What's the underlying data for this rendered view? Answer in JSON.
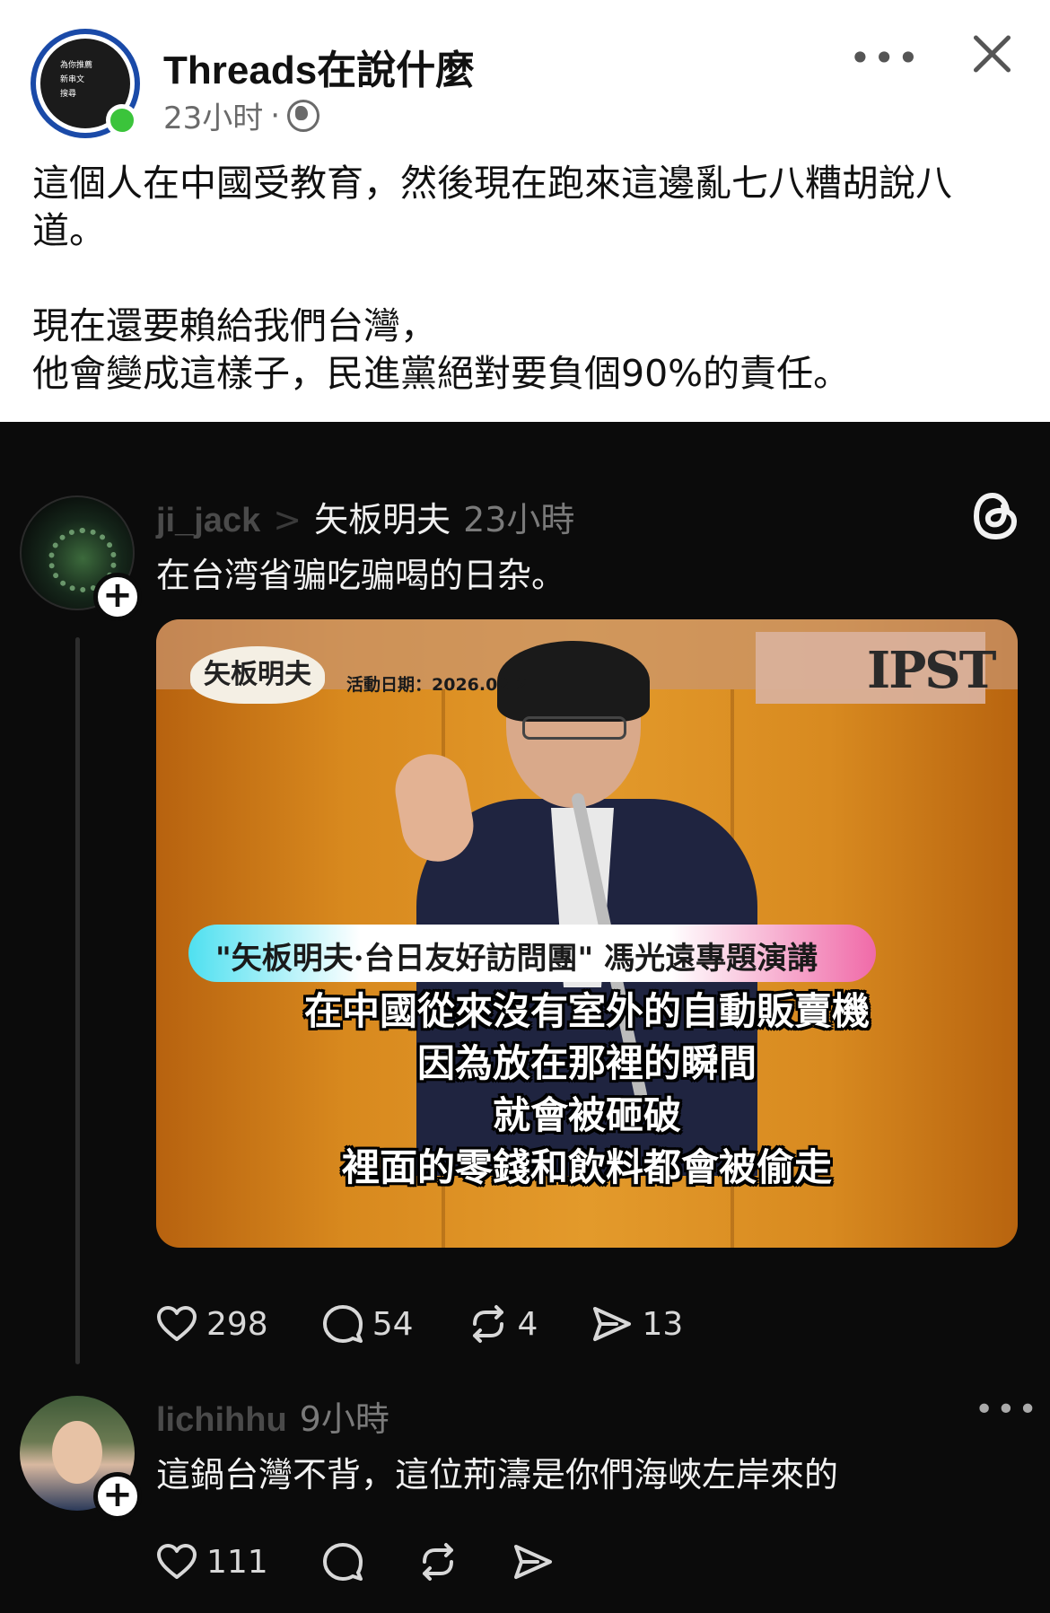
{
  "post": {
    "page_name": "Threads在說什麼",
    "time": "23小时",
    "dot": "·",
    "avatar_menu": [
      "為你推薦",
      "新串文",
      "搜尋"
    ],
    "paragraphs": [
      "這個人在中國受教育，然後現在跑來這邊亂七八糟胡說八道。",
      "現在還要賴給我們台灣，",
      "他會變成這樣子，民進黨絕對要負個90%的責任。"
    ],
    "more_label": "•••"
  },
  "thread": {
    "post1": {
      "username": "ji_jack",
      "arrow": ">",
      "reply_to": "矢板明夫",
      "time": "23小時",
      "text": "在台湾省骗吃骗喝的日杂。",
      "video": {
        "speaker_tag": "矢板明夫",
        "event_date": "活動日期：2026.02.21",
        "logo": "IPST",
        "banner": "\"矢板明夫·台日友好訪問團\" 馮光遠專題演講",
        "subtitles": [
          "在中國從來沒有室外的自動販賣機",
          "因為放在那裡的瞬間",
          "就會被砸破",
          "裡面的零錢和飲料都會被偷走"
        ]
      },
      "stats": {
        "likes": "298",
        "comments": "54",
        "reposts": "4",
        "shares": "13"
      }
    },
    "post2": {
      "username": "lichihhu",
      "time": "9小時",
      "text": "這鍋台灣不背，這位荊濤是你們海峽左岸來的",
      "more_label": "•••",
      "stats": {
        "likes": "111"
      }
    }
  },
  "colors": {
    "fb_ring": "#1a4aa8",
    "online": "#3bc43b",
    "dark_bg": "#0b0b0b"
  }
}
